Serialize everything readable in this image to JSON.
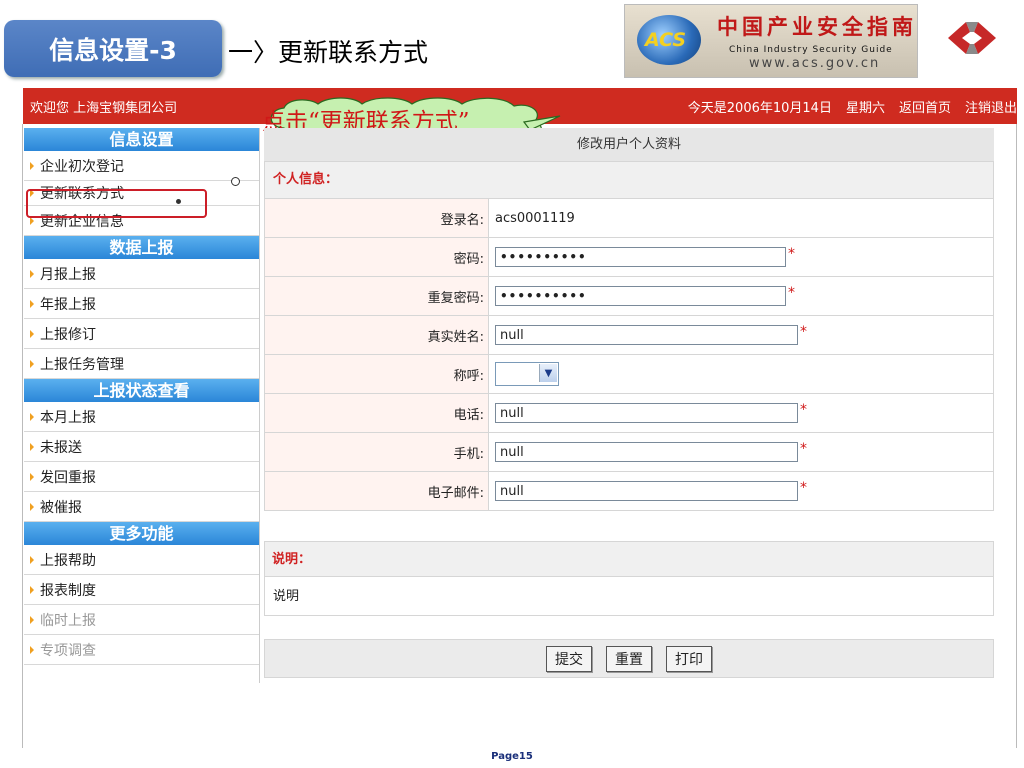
{
  "slide": {
    "tab_title": "信息设置-3",
    "subtitle": "一〉更新联系方式",
    "callout": "点击“更新联系方式”",
    "page_label": "Page15"
  },
  "logo": {
    "acs": "ACS",
    "cn_name": "中国产业安全指南",
    "en_name": "China  Industry  Security  Guide",
    "url": "www.acs.gov.cn"
  },
  "topbar": {
    "welcome": "欢迎您  上海宝钢集团公司",
    "date": "今天是2006年10月14日",
    "weekday": "星期六",
    "home_link": "返回首页",
    "logout_link": "注销退出",
    "bg_color": "#cf2b20"
  },
  "sidebar": {
    "sections": [
      {
        "header": "信息设置",
        "items": [
          "企业初次登记",
          "更新联系方式",
          "更新企业信息"
        ]
      },
      {
        "header": "数据上报",
        "items": [
          "月报上报",
          "年报上报",
          "上报修订",
          "上报任务管理"
        ]
      },
      {
        "header": "上报状态查看",
        "items": [
          "本月上报",
          "未报送",
          "发回重报",
          "被催报"
        ]
      },
      {
        "header": "更多功能",
        "items": [
          "上报帮助",
          "报表制度",
          "临时上报",
          "专项调查"
        ]
      }
    ],
    "highlight_color": "#cc1e28"
  },
  "form": {
    "title": "修改用户个人资料",
    "section": "个人信息：",
    "fields": {
      "login": {
        "label": "登录名:",
        "value": "acs0001119"
      },
      "password": {
        "label": "密码:",
        "value": "••••••••••"
      },
      "password2": {
        "label": "重复密码:",
        "value": "••••••••••"
      },
      "realname": {
        "label": "真实姓名:",
        "value": "null"
      },
      "title": {
        "label": "称呼:",
        "value": ""
      },
      "phone": {
        "label": "电话:",
        "value": "null"
      },
      "mobile": {
        "label": "手机:",
        "value": "null"
      },
      "email": {
        "label": "电子邮件:",
        "value": "null"
      }
    },
    "required_mark": "*"
  },
  "note": {
    "header": "说明：",
    "body": "说明"
  },
  "buttons": {
    "submit": "提交",
    "reset": "重置",
    "print": "打印"
  }
}
